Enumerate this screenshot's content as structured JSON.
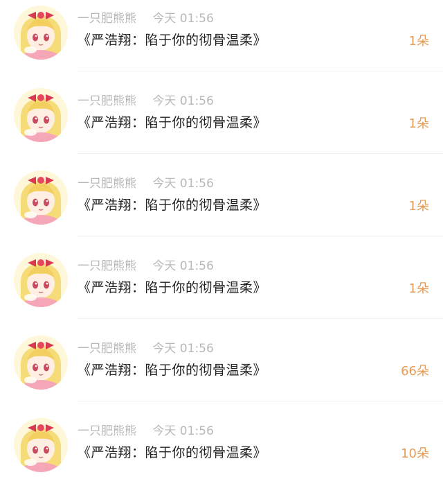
{
  "items": [
    {
      "user": "一只肥熊熊",
      "time": "今天 01:56",
      "title": "《严浩翔：陷于你的彻骨温柔》",
      "count": "1朵"
    },
    {
      "user": "一只肥熊熊",
      "time": "今天 01:56",
      "title": "《严浩翔：陷于你的彻骨温柔》",
      "count": "1朵"
    },
    {
      "user": "一只肥熊熊",
      "time": "今天 01:56",
      "title": "《严浩翔：陷于你的彻骨温柔》",
      "count": "1朵"
    },
    {
      "user": "一只肥熊熊",
      "time": "今天 01:56",
      "title": "《严浩翔：陷于你的彻骨温柔》",
      "count": "1朵"
    },
    {
      "user": "一只肥熊熊",
      "time": "今天 01:56",
      "title": "《严浩翔：陷于你的彻骨温柔》",
      "count": "66朵"
    },
    {
      "user": "一只肥熊熊",
      "time": "今天 01:56",
      "title": "《严浩翔：陷于你的彻骨温柔》",
      "count": "10朵"
    }
  ],
  "colors": {
    "meta": "#b8b8b8",
    "title": "#222222",
    "count": "#e69a52",
    "divider": "#efefef"
  },
  "icons": {
    "avatar": "anime-girl-avatar-icon"
  }
}
